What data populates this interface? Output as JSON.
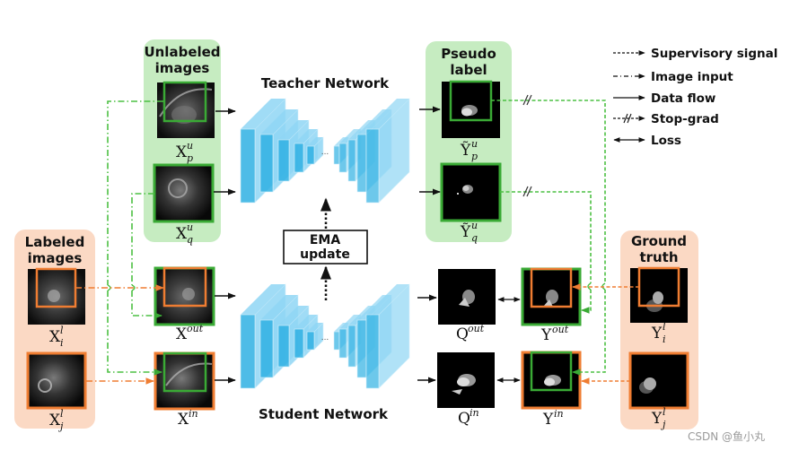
{
  "colors": {
    "green_panel": "#c6ecc1",
    "orange_panel": "#fbd9c4",
    "green": "#3aaa35",
    "green_line": "#4cc043",
    "orange": "#ef7d32",
    "block_light": "#8fd6f4",
    "block_dark": "#2fb0e3"
  },
  "panels": {
    "unlabeled": {
      "line1": "Unlabeled",
      "line2": "images"
    },
    "labeled": {
      "line1": "Labeled",
      "line2": "images"
    },
    "pseudo": {
      "line1": "Pseudo",
      "line2": "label"
    },
    "ground_truth": {
      "line1": "Ground",
      "line2": "truth"
    }
  },
  "networks": {
    "teacher": "Teacher Network",
    "student": "Student Network",
    "ellipsis": "...",
    "ema": {
      "line1": "EMA",
      "line2": "update"
    }
  },
  "images": {
    "xpu": {
      "base": "X",
      "sup": "u",
      "sub": "p"
    },
    "xqu": {
      "base": "X",
      "sup": "u",
      "sub": "q"
    },
    "xil": {
      "base": "X",
      "sup": "l",
      "sub": "i"
    },
    "xjl": {
      "base": "X",
      "sup": "l",
      "sub": "j"
    },
    "xout": {
      "base": "X",
      "sup": "out",
      "sub": ""
    },
    "xin": {
      "base": "X",
      "sup": "in",
      "sub": ""
    },
    "ypu": {
      "base": "Ỹ",
      "sup": "u",
      "sub": "p"
    },
    "yqu": {
      "base": "Ỹ",
      "sup": "u",
      "sub": "q"
    },
    "qout": {
      "base": "Q",
      "sup": "out",
      "sub": ""
    },
    "qin": {
      "base": "Q",
      "sup": "in",
      "sub": ""
    },
    "yout": {
      "base": "Y",
      "sup": "out",
      "sub": ""
    },
    "yin": {
      "base": "Y",
      "sup": "in",
      "sub": ""
    },
    "yil": {
      "base": "Y",
      "sup": "l",
      "sub": "i"
    },
    "yjl": {
      "base": "Y",
      "sup": "l",
      "sub": "j"
    }
  },
  "legend": [
    {
      "style": "dashed",
      "label": "Supervisory signal"
    },
    {
      "style": "dash-dot",
      "label": "Image input"
    },
    {
      "style": "solid",
      "label": "Data flow"
    },
    {
      "style": "stop-grad",
      "label": "Stop-grad"
    },
    {
      "style": "double-arrow",
      "label": "Loss"
    }
  ],
  "watermark": "CSDN @鱼小丸"
}
